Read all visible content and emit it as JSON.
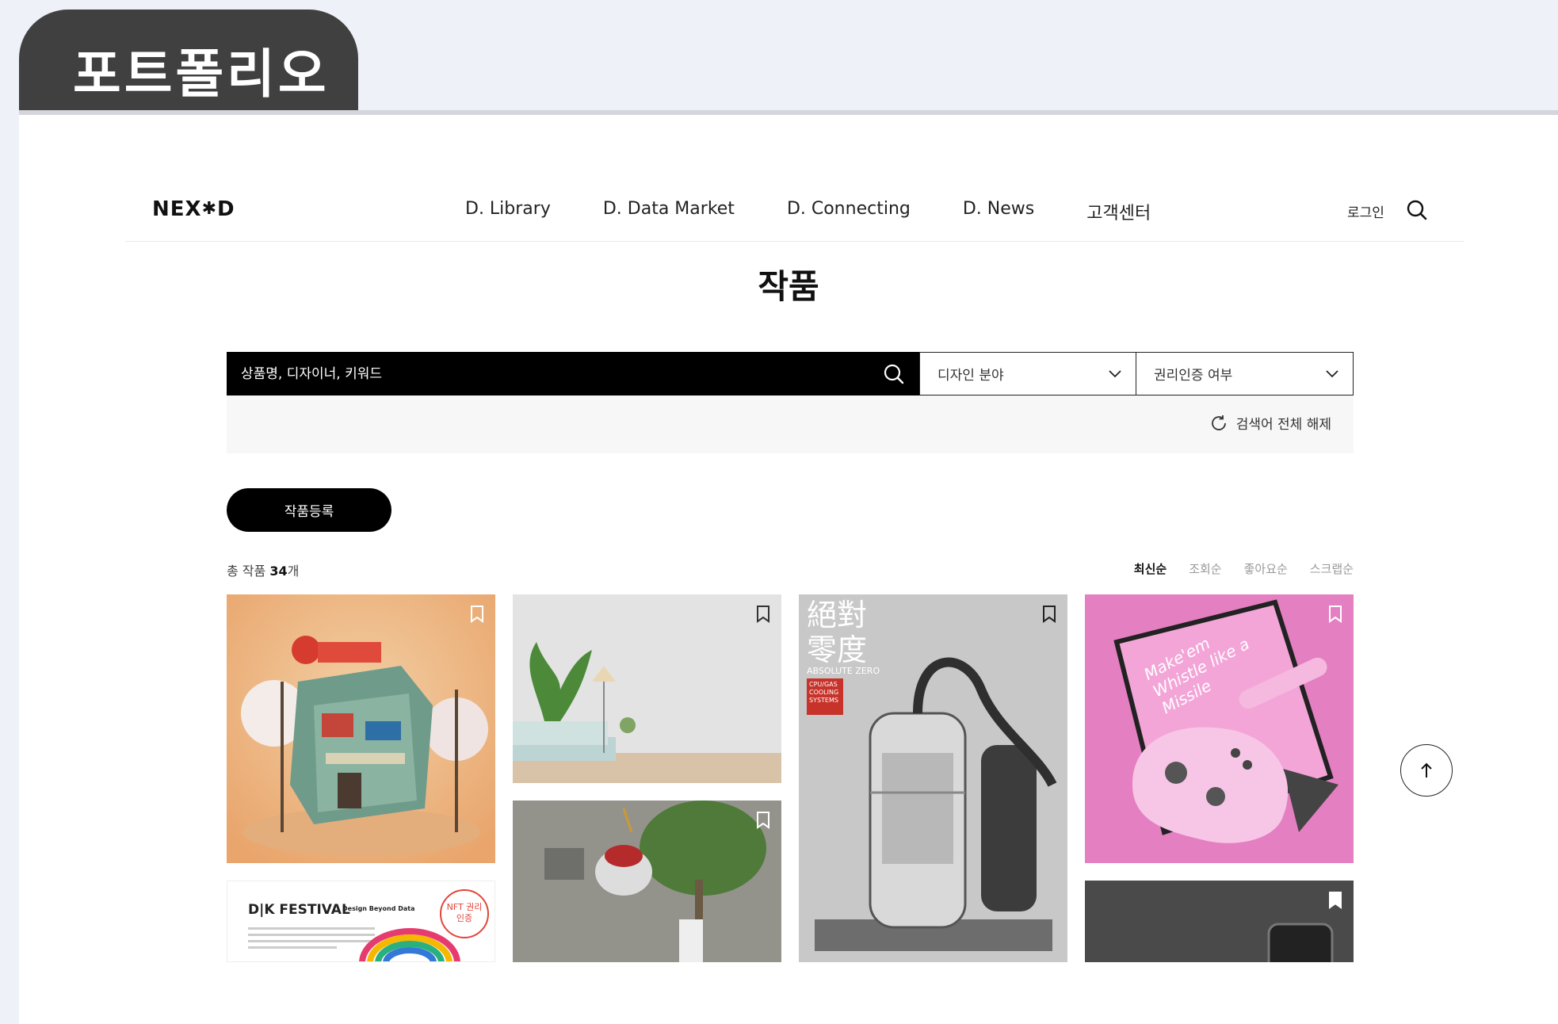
{
  "folder_tab": {
    "label": "포트폴리오"
  },
  "header": {
    "logo": "NEX✱D",
    "nav": [
      "D. Library",
      "D. Data Market",
      "D. Connecting",
      "D. News",
      "고객센터"
    ],
    "login": "로그인"
  },
  "page_title": "작품",
  "search": {
    "placeholder": "상품명, 디자이너, 키워드",
    "design_field": "디자인 분야",
    "rights_cert": "권리인증 여부",
    "reset_label": "검색어 전체 해제"
  },
  "register_button": "작품등록",
  "count": {
    "prefix": "총 작품 ",
    "number": "34",
    "suffix": "개"
  },
  "sort_options": [
    "최신순",
    "조회순",
    "좋아요순",
    "스크랩순"
  ],
  "sort_active": "최신순",
  "cards": [
    {
      "name": "card-miniature-building",
      "icon": "bookmark-icon"
    },
    {
      "name": "card-living-room",
      "icon": "bookmark-icon"
    },
    {
      "name": "card-absolute-zero",
      "icon": "bookmark-icon",
      "text_lines": [
        "絕對",
        "零度"
      ],
      "subtitle": "ABSOLUTE ZERO",
      "stamp": "CPU/GAS COOLING SYSTEMS"
    },
    {
      "name": "card-pink-controller",
      "icon": "bookmark-icon",
      "poster_text": "Make'em Whistle like a Missile"
    },
    {
      "name": "card-sculpture",
      "icon": "bookmark-icon"
    },
    {
      "name": "card-dk-festival",
      "icon": "bookmark-icon",
      "title": "D|K FESTIVAL",
      "subtitle": "Design Beyond Data",
      "badge": "NFT 권리 인증"
    },
    {
      "name": "card-dark-device",
      "icon": "bookmark-icon"
    }
  ],
  "colors": {
    "accent": "#000000",
    "page_bg": "#eef1f8",
    "tab_bg": "#404040"
  }
}
